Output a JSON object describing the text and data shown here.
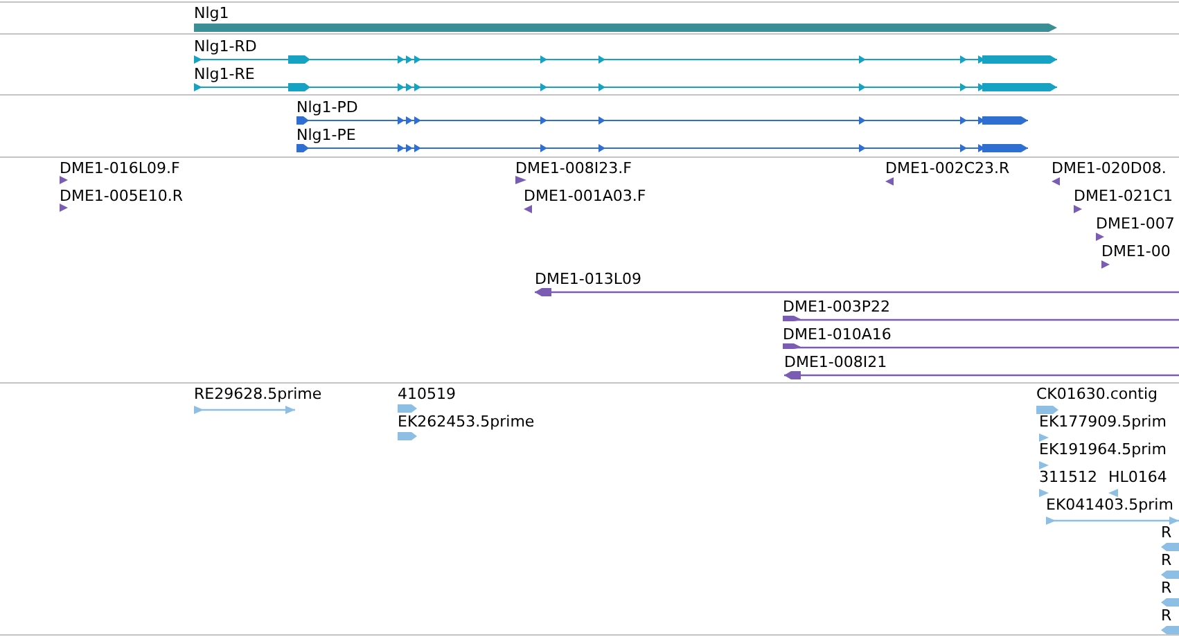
{
  "tracks": [
    {
      "features": [
        {
          "label": "Nlg1",
          "kind": "gene",
          "reverse": false
        }
      ]
    },
    {
      "features": [
        {
          "label": "Nlg1-RD",
          "kind": "rna",
          "reverse": false
        },
        {
          "label": "Nlg1-RE",
          "kind": "rna",
          "reverse": false
        }
      ]
    },
    {
      "features": [
        {
          "label": "Nlg1-PD",
          "kind": "protein",
          "reverse": false
        },
        {
          "label": "Nlg1-PE",
          "kind": "protein",
          "reverse": false
        }
      ]
    },
    {
      "features": [
        {
          "label": "DME1-016L09.F",
          "kind": "read",
          "reverse": false
        },
        {
          "label": "DME1-005E10.R",
          "kind": "read",
          "reverse": false
        },
        {
          "label": "DME1-008I23.F",
          "kind": "read",
          "reverse": false
        },
        {
          "label": "DME1-001A03.F",
          "kind": "read",
          "reverse": true
        },
        {
          "label": "DME1-002C23.R",
          "kind": "read",
          "reverse": true
        },
        {
          "label": "DME1-020D08.",
          "kind": "read",
          "reverse": true
        },
        {
          "label": "DME1-021C1",
          "kind": "read",
          "reverse": false
        },
        {
          "label": "DME1-007",
          "kind": "read",
          "reverse": false
        },
        {
          "label": "DME1-00",
          "kind": "read",
          "reverse": false
        },
        {
          "label": "DME1-013L09",
          "kind": "clone",
          "reverse": true
        },
        {
          "label": "DME1-003P22",
          "kind": "clone",
          "reverse": false
        },
        {
          "label": "DME1-010A16",
          "kind": "clone",
          "reverse": false
        },
        {
          "label": "DME1-008I21",
          "kind": "clone",
          "reverse": true
        }
      ]
    },
    {
      "features": [
        {
          "label": "RE29628.5prime",
          "kind": "est",
          "reverse": false
        },
        {
          "label": "410519",
          "kind": "est",
          "reverse": false
        },
        {
          "label": "EK262453.5prime",
          "kind": "est",
          "reverse": false
        },
        {
          "label": "CK01630.contig",
          "kind": "est",
          "reverse": false
        },
        {
          "label": "EK177909.5prim",
          "kind": "est",
          "reverse": false
        },
        {
          "label": "EK191964.5prim",
          "kind": "est",
          "reverse": false
        },
        {
          "label": "311512",
          "kind": "est",
          "reverse": false
        },
        {
          "label": "HL0164",
          "kind": "est",
          "reverse": true
        },
        {
          "label": "EK041403.5prim",
          "kind": "est",
          "reverse": false
        },
        {
          "label": "R",
          "kind": "est",
          "reverse": true
        },
        {
          "label": "R",
          "kind": "est",
          "reverse": true
        },
        {
          "label": "R",
          "kind": "est",
          "reverse": true
        },
        {
          "label": "R",
          "kind": "est",
          "reverse": true
        }
      ]
    }
  ]
}
